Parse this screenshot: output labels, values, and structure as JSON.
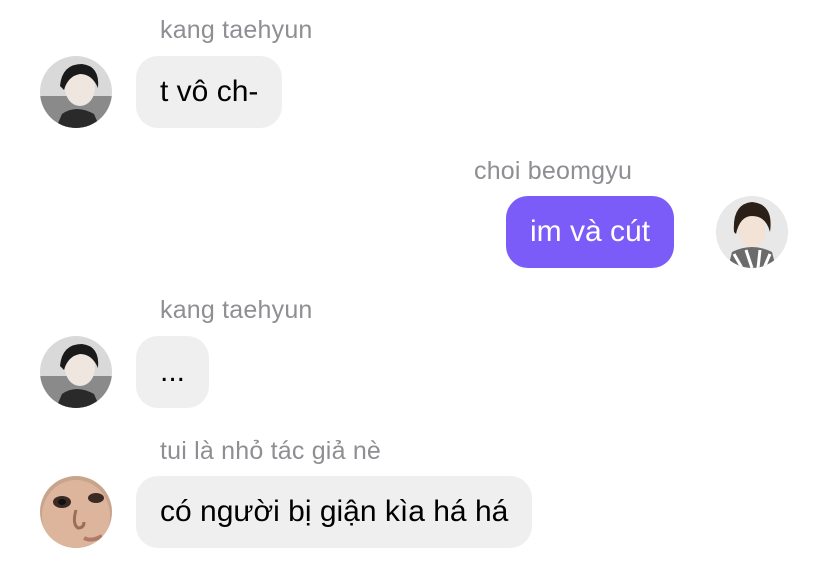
{
  "messages": [
    {
      "sender": "kang taehyun",
      "text": "t vô ch-",
      "direction": "incoming",
      "avatar_icon": "avatar-taehyun"
    },
    {
      "sender": "choi beomgyu",
      "text": "im và cút",
      "direction": "outgoing",
      "avatar_icon": "avatar-beomgyu"
    },
    {
      "sender": "kang taehyun",
      "text": "...",
      "direction": "incoming",
      "avatar_icon": "avatar-taehyun"
    },
    {
      "sender": "tui là nhỏ tác giả nè",
      "text": "có người bị giận kìa há há",
      "direction": "incoming",
      "avatar_icon": "avatar-author"
    }
  ],
  "colors": {
    "incoming_bubble": "#efefef",
    "outgoing_bubble": "#7c5cf8",
    "sender_label": "#8e8e93"
  }
}
